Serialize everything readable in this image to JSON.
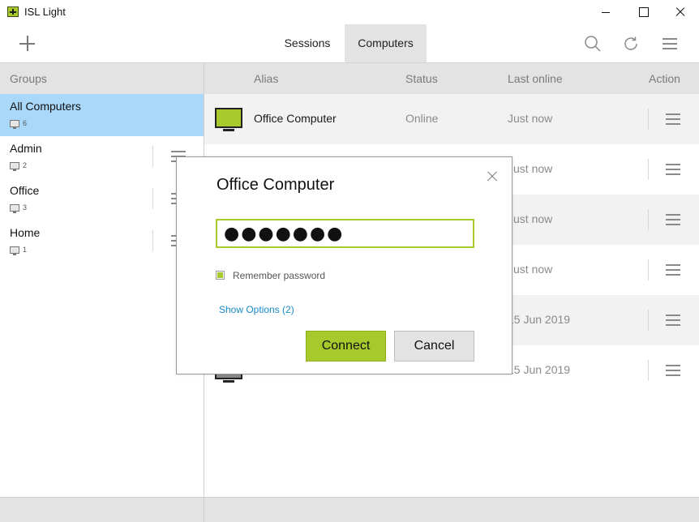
{
  "window": {
    "title": "ISL Light"
  },
  "toolbar": {
    "tabs": [
      {
        "label": "Sessions",
        "active": false
      },
      {
        "label": "Computers",
        "active": true
      }
    ],
    "icons": [
      "plus-icon",
      "search-icon",
      "refresh-icon",
      "hamburger-menu-icon"
    ]
  },
  "groups": {
    "header": "Groups",
    "items": [
      {
        "name": "All Computers",
        "count": "6",
        "selected": true
      },
      {
        "name": "Admin",
        "count": "2",
        "selected": false
      },
      {
        "name": "Office",
        "count": "3",
        "selected": false
      },
      {
        "name": "Home",
        "count": "1",
        "selected": false
      }
    ]
  },
  "table": {
    "headers": {
      "alias": "Alias",
      "status": "Status",
      "last_online": "Last online",
      "action": "Action"
    },
    "rows": [
      {
        "alias": "Office Computer",
        "status": "Online",
        "last_online": "Just now",
        "state": "online"
      },
      {
        "alias": "",
        "status": "",
        "last_online": "Just now",
        "state": "online"
      },
      {
        "alias": "",
        "status": "",
        "last_online": "Just now",
        "state": "online"
      },
      {
        "alias": "",
        "status": "",
        "last_online": "Just now",
        "state": "online"
      },
      {
        "alias": "",
        "status": "",
        "last_online": "15 Jun 2019",
        "state": "offline"
      },
      {
        "alias": "",
        "status": "",
        "last_online": "15 Jun 2019",
        "state": "offline"
      }
    ]
  },
  "dialog": {
    "title": "Office Computer",
    "password_value": "●●●●●●●",
    "remember_label": "Remember password",
    "remember_checked": true,
    "options_link": "Show Options (2)",
    "connect_label": "Connect",
    "cancel_label": "Cancel"
  },
  "colors": {
    "accent_green": "#a8c92b",
    "selected_blue": "#a9d8fb",
    "link_blue": "#1b8ac9",
    "header_gray": "#e3e3e3"
  }
}
